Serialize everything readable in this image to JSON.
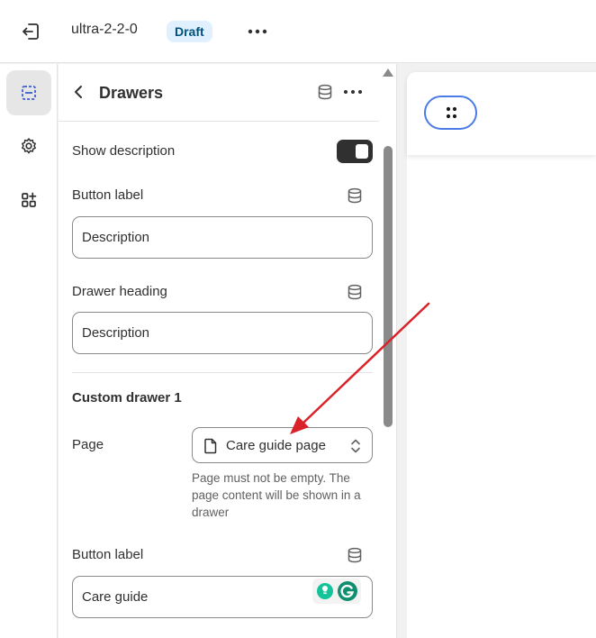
{
  "topbar": {
    "theme_name": "ultra-2-2-0",
    "status_badge": "Draft"
  },
  "rail": {
    "items": [
      "sections-icon",
      "settings-icon",
      "apps-icon"
    ],
    "active_index": 0
  },
  "panel": {
    "title": "Drawers",
    "show_description_label": "Show description",
    "show_description_on": true,
    "button_label_1": "Button label",
    "button_label_1_value": "Description",
    "drawer_heading_label": "Drawer heading",
    "drawer_heading_value": "Description",
    "section_title": "Custom drawer 1",
    "page_label": "Page",
    "page_value": "Care guide page",
    "page_help": "Page must not be empty. The page content will be shown in a drawer",
    "button_label_2": "Button label",
    "button_label_2_value": "Care guide"
  },
  "colors": {
    "accent": "#4b7be6",
    "badge_bg": "#e0f0ff",
    "annotation_arrow": "#d9222a",
    "grammarly_green": "#15c39a"
  }
}
